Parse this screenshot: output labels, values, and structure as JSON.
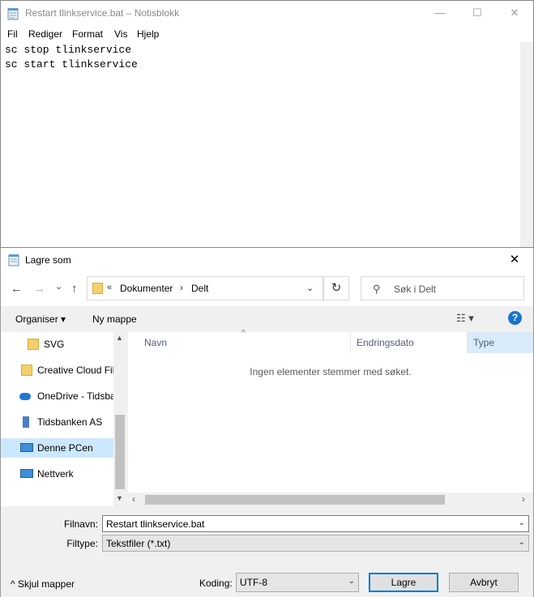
{
  "notepad": {
    "title": "Restart tlinkservice.bat – Notisblokk",
    "caption_buttons": {
      "minimize": "—",
      "maximize": "☐",
      "close": "✕"
    },
    "menu": [
      "Fil",
      "Rediger",
      "Format",
      "Vis",
      "Hjelp"
    ],
    "lines": [
      "sc stop tlinkservice",
      "sc start tlinkservice"
    ]
  },
  "dialog": {
    "title": "Lagre som",
    "close_glyph": "✕",
    "nav": {
      "back": "←",
      "forward": "→",
      "recent": "⌄",
      "up": "↑"
    },
    "address": {
      "overflow": "«",
      "crumbs": [
        "Dokumenter",
        "Delt"
      ],
      "separator": "›",
      "dropdown": "⌄"
    },
    "refresh_glyph": "↻",
    "search": {
      "icon": "⚲",
      "placeholder": "Søk i Delt"
    },
    "toolbar": {
      "organise": "Organiser ▾",
      "new_folder": "Ny mappe",
      "view_glyph": "☷ ▾",
      "help": "?"
    },
    "nav_pane": [
      {
        "label": "SVG",
        "icon": "folder-icon"
      },
      {
        "label": "Creative Cloud Fil",
        "icon": "creative-cloud-icon"
      },
      {
        "label": "OneDrive - Tidsba",
        "icon": "onedrive-icon"
      },
      {
        "label": "Tidsbanken AS",
        "icon": "building-icon"
      },
      {
        "label": "Denne PCen",
        "icon": "computer-icon",
        "selected": true
      },
      {
        "label": "Nettverk",
        "icon": "network-icon"
      }
    ],
    "columns": [
      "Navn",
      "Endringsdato",
      "Type"
    ],
    "empty_message": "Ingen elementer stemmer med søket.",
    "filename_label": "Filnavn:",
    "filename_value": "Restart tlinkservice.bat",
    "filetype_label": "Filtype:",
    "filetype_value": "Tekstfiler (*.txt)",
    "hide_folders": "^ Skjul mapper",
    "encoding_label": "Koding:",
    "encoding_value": "UTF-8",
    "save_button": "Lagre",
    "cancel_button": "Avbryt",
    "dropdown_glyph": "⌄",
    "colors": {
      "accent": "#0078d7",
      "selected_bg": "#cce8ff",
      "help": "#1874d1"
    }
  }
}
